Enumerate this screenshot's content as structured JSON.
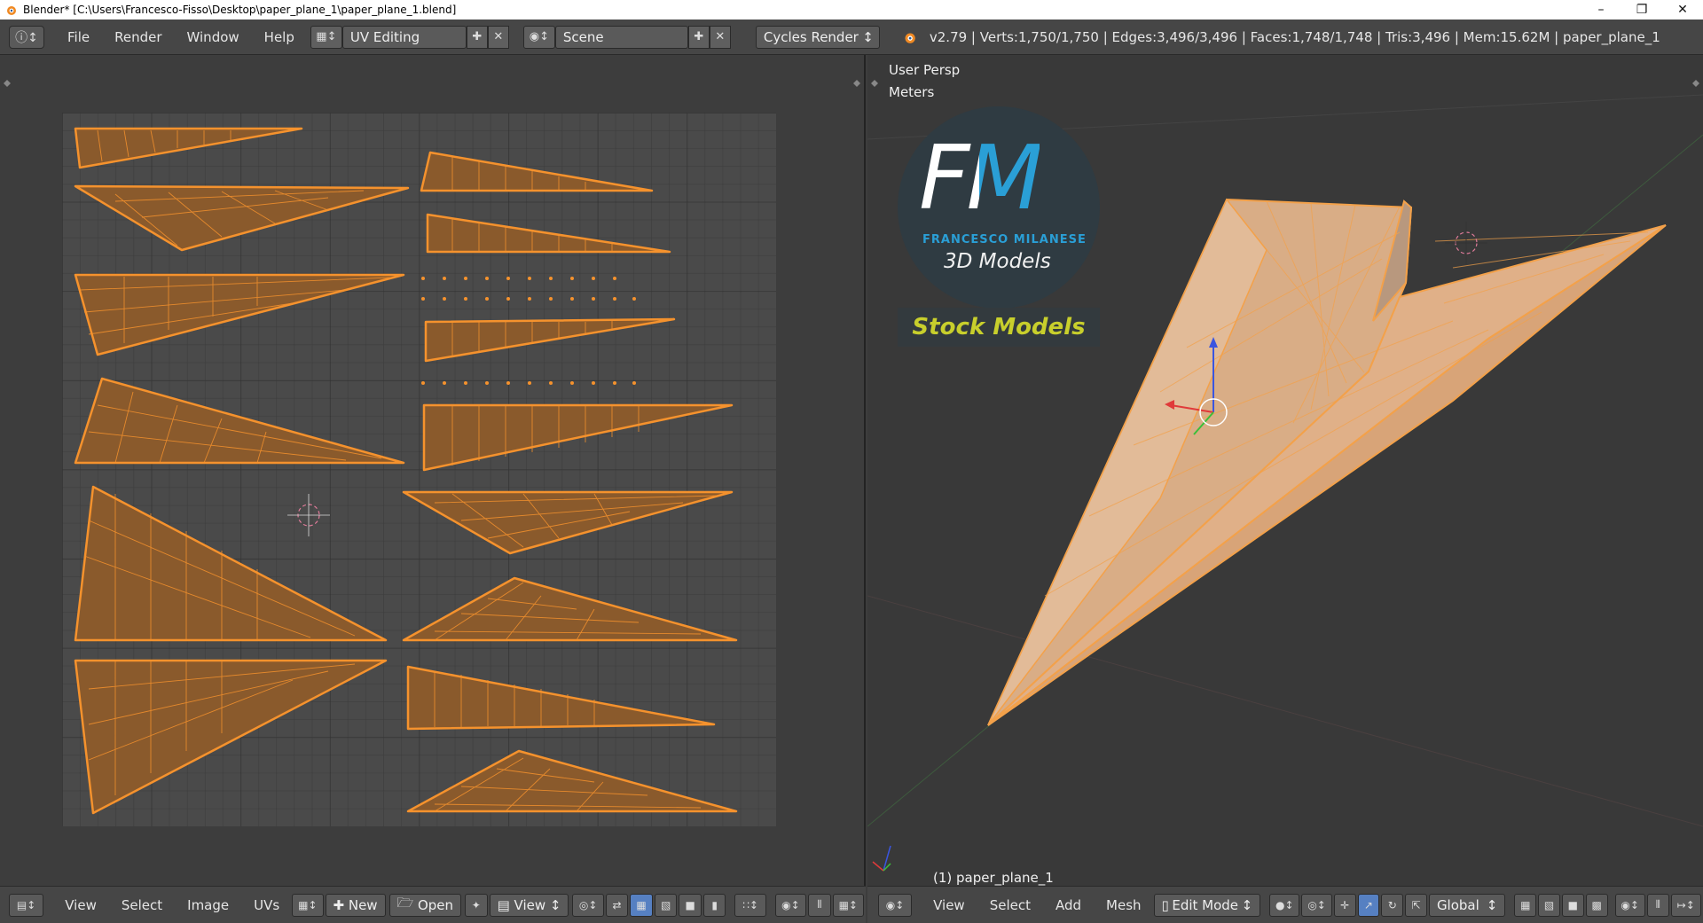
{
  "window": {
    "title": "Blender* [C:\\Users\\Francesco-Fisso\\Desktop\\paper_plane_1\\paper_plane_1.blend]"
  },
  "info_header": {
    "menus": [
      "File",
      "Render",
      "Window",
      "Help"
    ],
    "screen_layout": "UV Editing",
    "scene": "Scene",
    "render_engine": "Cycles Render",
    "stats": "v2.79 | Verts:1,750/1,750 | Edges:3,496/3,496 | Faces:1,748/1,748 | Tris:3,496 | Mem:15.62M | paper_plane_1"
  },
  "viewport": {
    "view_name": "User Persp",
    "units": "Meters",
    "object_label": "(1) paper_plane_1"
  },
  "logo": {
    "initials": "FM",
    "name": "FRANCESCO MILANESE",
    "tagline": "3D Models",
    "banner": "Stock Models"
  },
  "uv_header": {
    "menus": [
      "View",
      "Select",
      "Image",
      "UVs"
    ],
    "new_label": "New",
    "open_label": "Open",
    "view_label": "View"
  },
  "view3d_header": {
    "menus": [
      "View",
      "Select",
      "Add",
      "Mesh"
    ],
    "mode": "Edit Mode",
    "orientation": "Global"
  },
  "colors": {
    "uv_mesh": "#f5922d",
    "uv_fill": "#8a5a2c",
    "grid_bg": "#4a4a4a",
    "plane": "#f3a14a",
    "logo_blue": "#2a9fd6"
  }
}
